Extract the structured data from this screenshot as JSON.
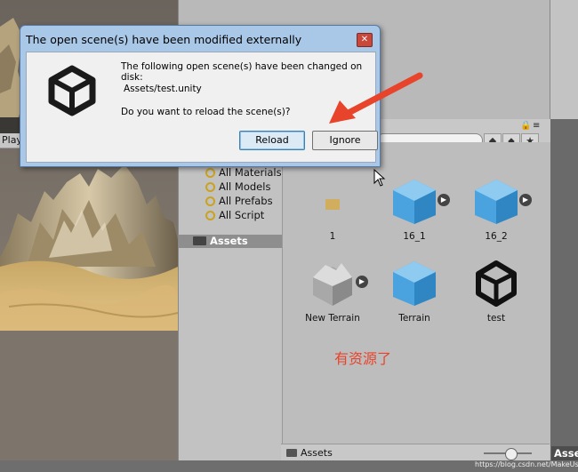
{
  "dialog": {
    "title": "The open scene(s) have been modified externally",
    "line1": "The following open scene(s) have been changed on",
    "line2": "disk:",
    "line3": "Assets/test.unity",
    "question": "Do you want to reload the scene(s)?",
    "reload_label": "Reload",
    "ignore_label": "Ignore",
    "close_glyph": "✕"
  },
  "scene_tab": {
    "label": "Play"
  },
  "project": {
    "tree": [
      {
        "label": "All Materials",
        "icon": "search-filter-icon"
      },
      {
        "label": "All Models",
        "icon": "search-filter-icon"
      },
      {
        "label": "All Prefabs",
        "icon": "search-filter-icon"
      },
      {
        "label": "All Script",
        "icon": "search-filter-icon"
      }
    ],
    "assets_label": "Assets",
    "assets": [
      {
        "name": "1",
        "icon": "folder-icon"
      },
      {
        "name": "16_1",
        "icon": "cube-icon"
      },
      {
        "name": "16_2",
        "icon": "cube-icon"
      },
      {
        "name": "New Terrain",
        "icon": "terrain-icon"
      },
      {
        "name": "Terrain",
        "icon": "cube-icon"
      },
      {
        "name": "test",
        "icon": "unity-logo-icon"
      }
    ],
    "breadcrumb": "Assets"
  },
  "annotation": "有资源了",
  "right_panel_label": "Asse",
  "watermark": "https://blog.csdn.net/MakeUsn",
  "colors": {
    "annotation_red": "#e8432b",
    "dialog_frame": "#a9c8e8",
    "cube_blue": "#4aa3de"
  }
}
